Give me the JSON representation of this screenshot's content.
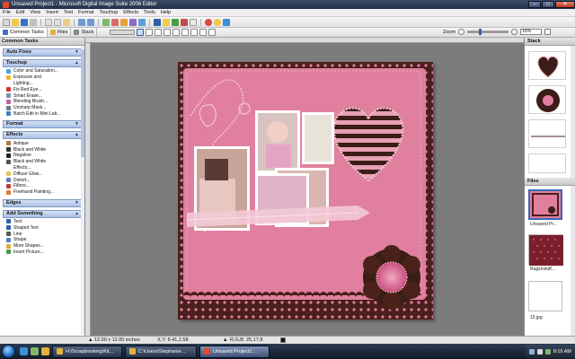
{
  "window": {
    "title": "Unsaved Project1 - Microsoft Digital Image Suite 2006 Editor",
    "buttons": {
      "minimize": "–",
      "maximize": "□",
      "close": "✕"
    }
  },
  "menu": [
    "File",
    "Edit",
    "View",
    "Insert",
    "Text",
    "Format",
    "Touchup",
    "Effects",
    "Tools",
    "Help"
  ],
  "toolbar": {
    "common_tasks_tab": "Common Tasks",
    "files_tab": "Files",
    "stack_tab": "Stack",
    "zoom_label": "Zoom",
    "zoom_value": "16%",
    "zoom_level_fraction": 0.3
  },
  "left_pane": {
    "header": "Common Tasks",
    "sections": [
      {
        "title": "Auto Fixes",
        "collapsed": true,
        "items": []
      },
      {
        "title": "Touchup",
        "collapsed": false,
        "items": [
          {
            "label": "Color and Saturation...",
            "color": "#4aa3df"
          },
          {
            "label": "Exposure and",
            "color": "#f2b632"
          },
          {
            "label": "Lighting...",
            "color": "",
            "indent": true
          },
          {
            "label": "Fix Red Eye...",
            "color": "#d7332a"
          },
          {
            "label": "Smart Erase...",
            "color": "#7f8fa8"
          },
          {
            "label": "Blending Brush...",
            "color": "#c15fa8"
          },
          {
            "label": "Unsharp Mask...",
            "color": "#6a7c94"
          },
          {
            "label": "Batch Edit in Mini Lab...",
            "color": "#3f7fbf"
          }
        ]
      },
      {
        "title": "Format",
        "collapsed": true,
        "items": []
      },
      {
        "title": "Effects",
        "collapsed": false,
        "items": [
          {
            "label": "Antique",
            "color": "#b07a3f"
          },
          {
            "label": "Black and White",
            "color": "#333333"
          },
          {
            "label": "Negative",
            "color": "#222222"
          },
          {
            "label": "Black and White",
            "color": "#555555"
          },
          {
            "label": "Effects...",
            "color": "",
            "indent": true
          },
          {
            "label": "Diffuse Glow...",
            "color": "#e8c35a"
          },
          {
            "label": "Distort...",
            "color": "#5d7fb8"
          },
          {
            "label": "Filters...",
            "color": "#c03b3b"
          },
          {
            "label": "Freehand Painting...",
            "color": "#e07a2f"
          }
        ]
      },
      {
        "title": "Edges",
        "collapsed": true,
        "items": []
      },
      {
        "title": "Add Something",
        "collapsed": false,
        "items": [
          {
            "label": "Text",
            "color": "#2f5fa8"
          },
          {
            "label": "Shaped Text",
            "color": "#2f5fa8"
          },
          {
            "label": "Line",
            "color": "#555555"
          },
          {
            "label": "Shape",
            "color": "#4a7fc8"
          },
          {
            "label": "More Shapes...",
            "color": "#e0a93a"
          },
          {
            "label": "Insert Picture...",
            "color": "#4a9a4a"
          }
        ]
      }
    ]
  },
  "stack_panel": {
    "title": "Stack"
  },
  "files_panel": {
    "title": "Files",
    "files": [
      {
        "label": "Unsaved Pr...",
        "selected": true
      },
      {
        "label": "Rugsnstuff...",
        "selected": false
      },
      {
        "label": "15.jpg",
        "selected": false
      }
    ]
  },
  "status": {
    "dimensions": "12.00 x 12.00 inches",
    "coords": "X,Y: 8.41,1.58",
    "rgb": "R,G,B: 25,17,8",
    "swatch_color": "#191108"
  },
  "taskbar": {
    "buttons": [
      {
        "label": "H:\\Scrapbooking\\Kit...",
        "active": false,
        "color": "#e3b23c"
      },
      {
        "label": "C:\\Users\\Stephanie...",
        "active": false,
        "color": "#e3b23c"
      },
      {
        "label": "Unsaved Project1 ...",
        "active": true,
        "color": "#e04a2a"
      }
    ],
    "clock": "8:16 AM"
  },
  "colors": {
    "page_pink": "#e07f9e",
    "border_brown": "#4a1f1c",
    "photo_frame": "#ffffff",
    "ribbon": "#f4c9d6"
  }
}
